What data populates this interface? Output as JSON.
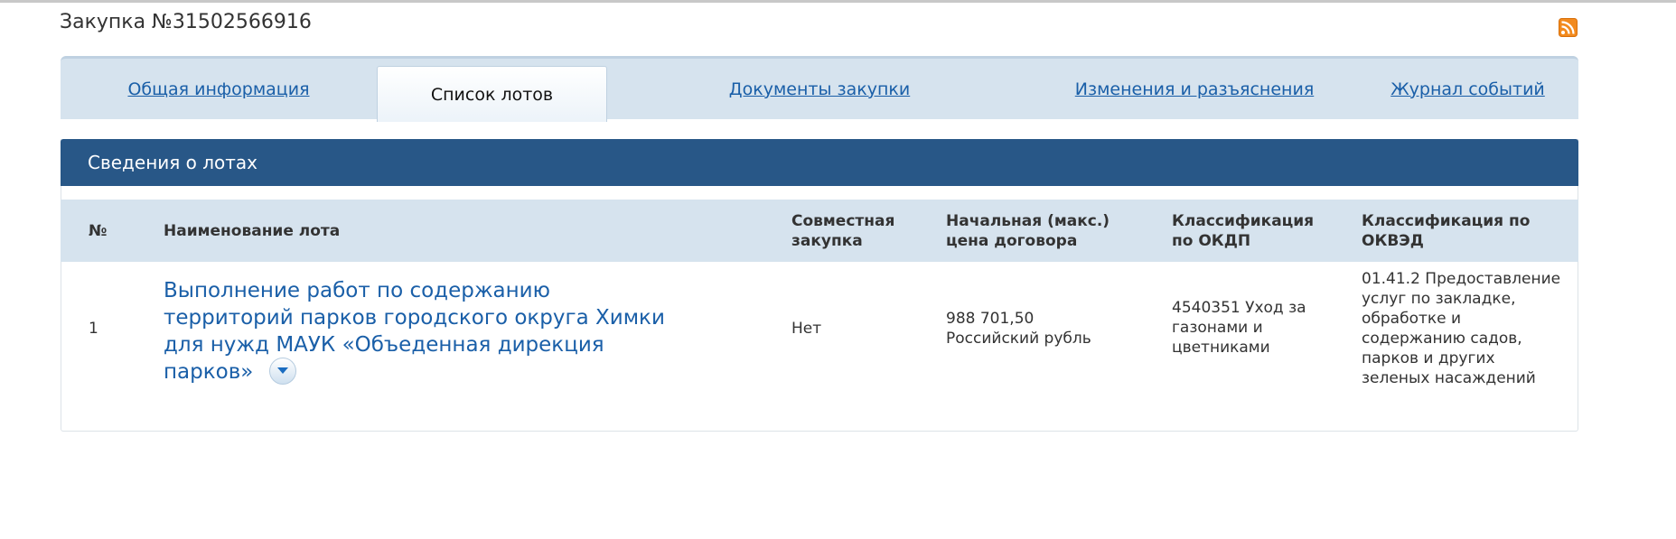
{
  "page": {
    "title": "Закупка №31502566916"
  },
  "icons": {
    "rss": "rss-icon",
    "expand": "chevron-down-icon"
  },
  "colors": {
    "link": "#1a5fa8",
    "header_bg": "#285787",
    "tab_bar_bg": "#d6e3ee",
    "rss": "#f28a1e"
  },
  "tabs": [
    {
      "label": "Общая информация",
      "active": false
    },
    {
      "label": "Список лотов",
      "active": true
    },
    {
      "label": "Документы закупки",
      "active": false
    },
    {
      "label": "Изменения и разъяснения",
      "active": false
    },
    {
      "label": "Журнал событий",
      "active": false
    }
  ],
  "lots_panel": {
    "title": "Сведения о лотах",
    "columns": [
      "№",
      "Наименование лота",
      "Совместная закупка",
      "Начальная (макс.) цена договора",
      "Классификация по ОКДП",
      "Классификация по ОКВЭД"
    ],
    "rows": [
      {
        "number": "1",
        "name": "Выполнение работ по содержанию территорий парков городского округа Химки для нужд МАУК «Объеденная дирекция парков»",
        "joint": "Нет",
        "price": "988 701,50 Российский рубль",
        "okdp": "4540351 Уход за газонами и цветниками",
        "okved": "01.41.2 Предоставление услуг по закладке, обработке и содержанию садов, парков и других зеленых насаждений"
      }
    ]
  }
}
